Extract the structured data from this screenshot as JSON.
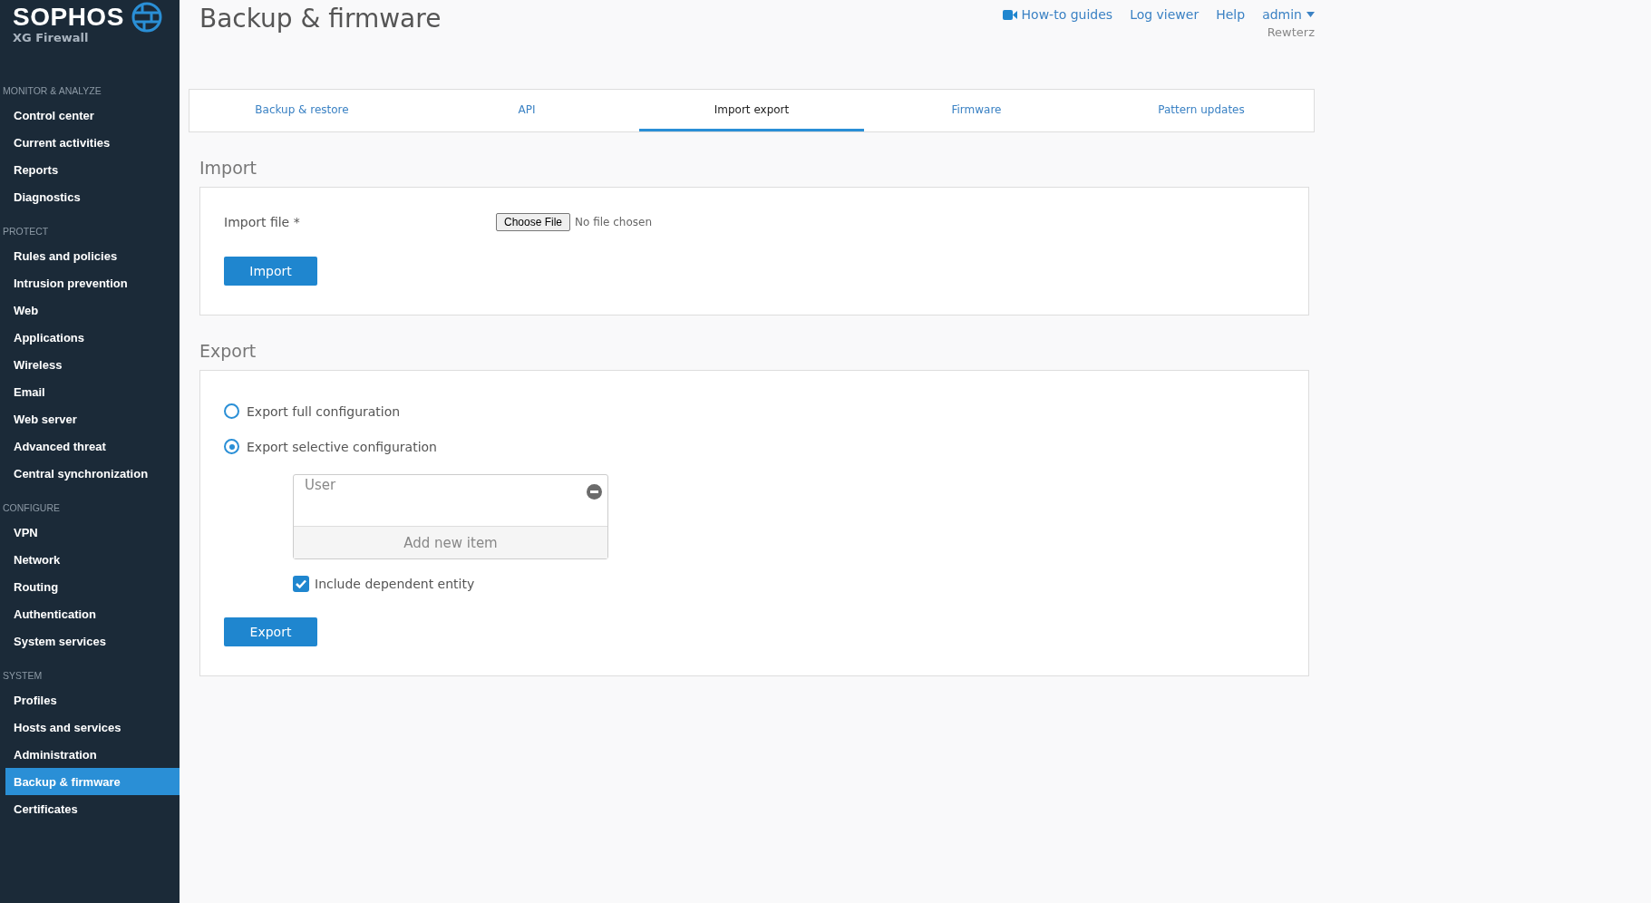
{
  "brand": {
    "name": "SOPHOS",
    "product": "XG Firewall"
  },
  "sidebar": {
    "sections": [
      {
        "title": "MONITOR & ANALYZE",
        "items": [
          {
            "label": "Control center",
            "selected": false
          },
          {
            "label": "Current activities",
            "selected": false
          },
          {
            "label": "Reports",
            "selected": false
          },
          {
            "label": "Diagnostics",
            "selected": false
          }
        ]
      },
      {
        "title": "PROTECT",
        "items": [
          {
            "label": "Rules and policies",
            "selected": false
          },
          {
            "label": "Intrusion prevention",
            "selected": false
          },
          {
            "label": "Web",
            "selected": false
          },
          {
            "label": "Applications",
            "selected": false
          },
          {
            "label": "Wireless",
            "selected": false
          },
          {
            "label": "Email",
            "selected": false
          },
          {
            "label": "Web server",
            "selected": false
          },
          {
            "label": "Advanced threat",
            "selected": false
          },
          {
            "label": "Central synchronization",
            "selected": false
          }
        ]
      },
      {
        "title": "CONFIGURE",
        "items": [
          {
            "label": "VPN",
            "selected": false
          },
          {
            "label": "Network",
            "selected": false
          },
          {
            "label": "Routing",
            "selected": false
          },
          {
            "label": "Authentication",
            "selected": false
          },
          {
            "label": "System services",
            "selected": false
          }
        ]
      },
      {
        "title": "SYSTEM",
        "items": [
          {
            "label": "Profiles",
            "selected": false
          },
          {
            "label": "Hosts and services",
            "selected": false
          },
          {
            "label": "Administration",
            "selected": false
          },
          {
            "label": "Backup & firmware",
            "selected": true
          },
          {
            "label": "Certificates",
            "selected": false
          }
        ]
      }
    ]
  },
  "page": {
    "title": "Backup & firmware"
  },
  "header_links": [
    {
      "label": "How-to guides",
      "kind": "video"
    },
    {
      "label": "Log viewer",
      "kind": "plain"
    },
    {
      "label": "Help",
      "kind": "plain"
    },
    {
      "label": "admin",
      "kind": "menu"
    }
  ],
  "user_org": "Rewterz",
  "tabs": [
    {
      "label": "Backup & restore",
      "selected": false
    },
    {
      "label": "API",
      "selected": false
    },
    {
      "label": "Import export",
      "selected": true
    },
    {
      "label": "Firmware",
      "selected": false
    },
    {
      "label": "Pattern updates",
      "selected": false
    }
  ],
  "import": {
    "heading": "Import",
    "field_label": "Import file *",
    "file_button": "Choose File",
    "file_status": "No file chosen",
    "button": "Import"
  },
  "export": {
    "heading": "Export",
    "options": [
      {
        "label": "Export full configuration",
        "selected": false
      },
      {
        "label": "Export selective configuration",
        "selected": true
      }
    ],
    "list": {
      "items": [
        "User"
      ],
      "add_label": "Add new item"
    },
    "include_dependent": {
      "label": "Include dependent entity",
      "checked": true
    },
    "button": "Export"
  }
}
